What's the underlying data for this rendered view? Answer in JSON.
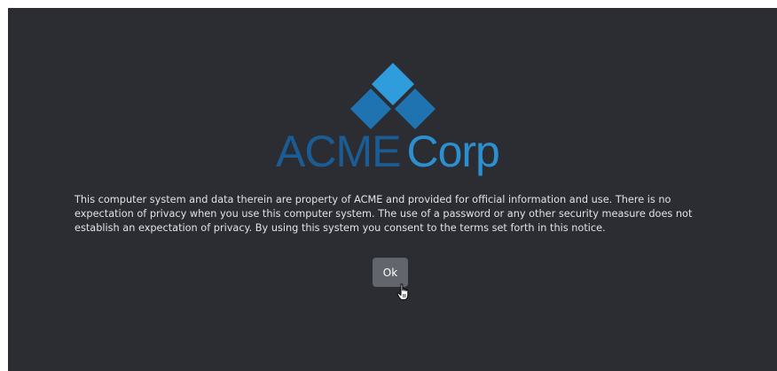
{
  "logo": {
    "word_primary": "ACME",
    "word_secondary": "Corp",
    "color_primary": "#1a5c93",
    "color_secondary": "#2b8fd0"
  },
  "notice": {
    "text": "This computer system and data therein are property of ACME and provided for official information and use. There is no expectation of privacy when you use this computer system. The use of a password or any other security measure does not establish an expectation of privacy. By using this system you consent to the terms set forth in this notice."
  },
  "actions": {
    "ok_label": "Ok"
  },
  "colors": {
    "background": "#2b2d32",
    "button": "#62666c",
    "text": "#e3e3e3"
  },
  "cursor": {
    "icon": "hand-pointer-icon"
  }
}
